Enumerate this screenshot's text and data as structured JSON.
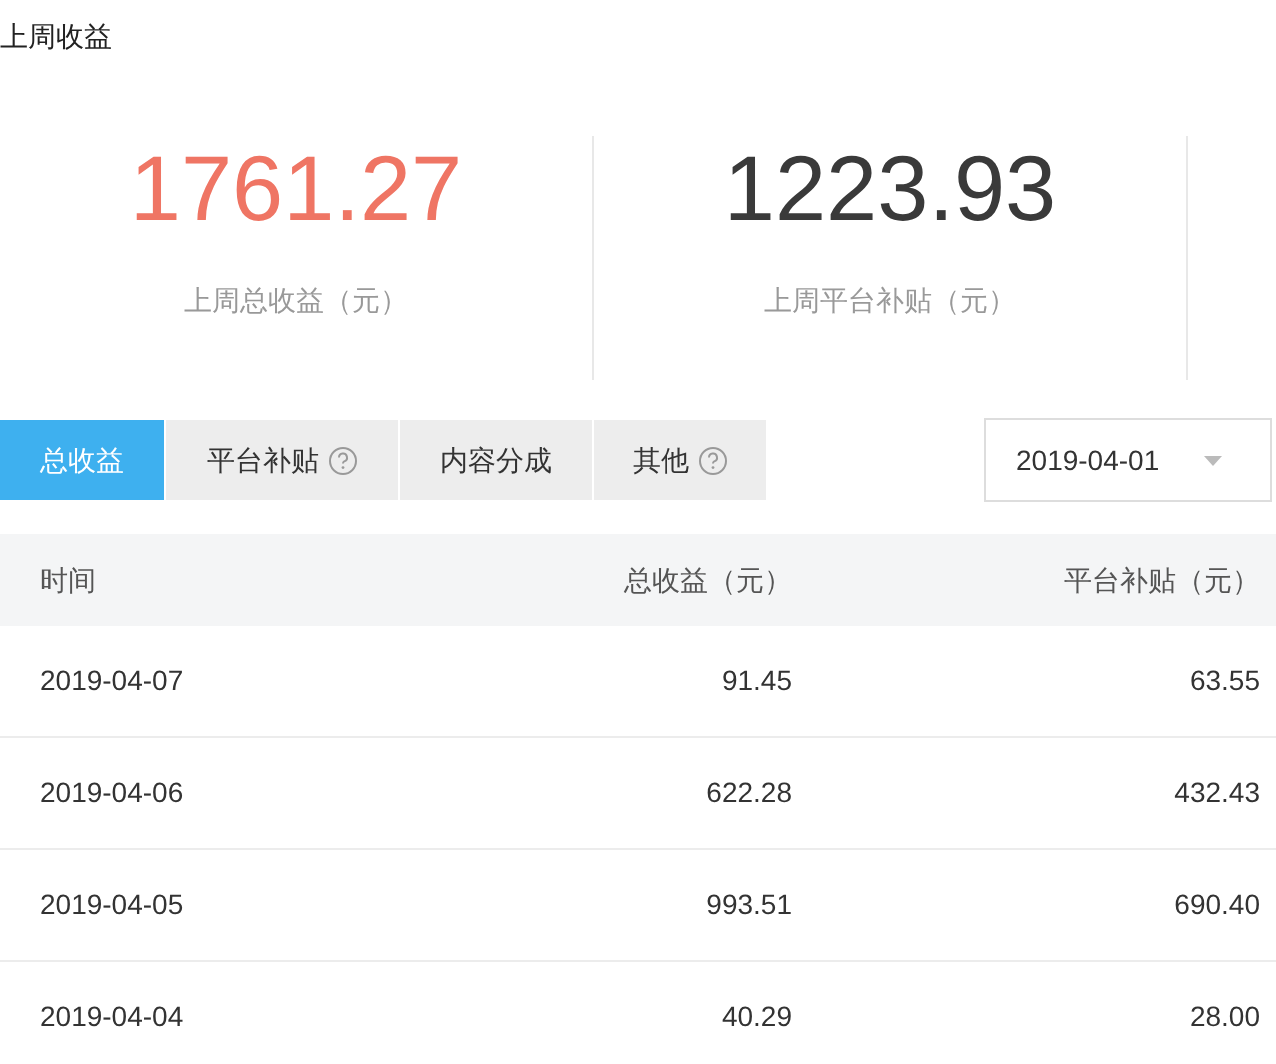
{
  "section_title": "上周收益",
  "stats": [
    {
      "value": "1761.27",
      "label": "上周总收益（元）",
      "color": "#ef7564"
    },
    {
      "value": "1223.93",
      "label": "上周平台补贴（元）",
      "color": "#3a3a3a"
    }
  ],
  "tabs": [
    {
      "label": "总收益",
      "selected": true,
      "help": false
    },
    {
      "label": "平台补贴",
      "selected": false,
      "help": true
    },
    {
      "label": "内容分成",
      "selected": false,
      "help": false
    },
    {
      "label": "其他",
      "selected": false,
      "help": true
    }
  ],
  "date_picker": {
    "value": "2019-04-01"
  },
  "table": {
    "columns": [
      "时间",
      "总收益（元）",
      "平台补贴（元）"
    ],
    "rows": [
      [
        "2019-04-07",
        "91.45",
        "63.55"
      ],
      [
        "2019-04-06",
        "622.28",
        "432.43"
      ],
      [
        "2019-04-05",
        "993.51",
        "690.40"
      ],
      [
        "2019-04-04",
        "40.29",
        "28.00"
      ]
    ]
  }
}
